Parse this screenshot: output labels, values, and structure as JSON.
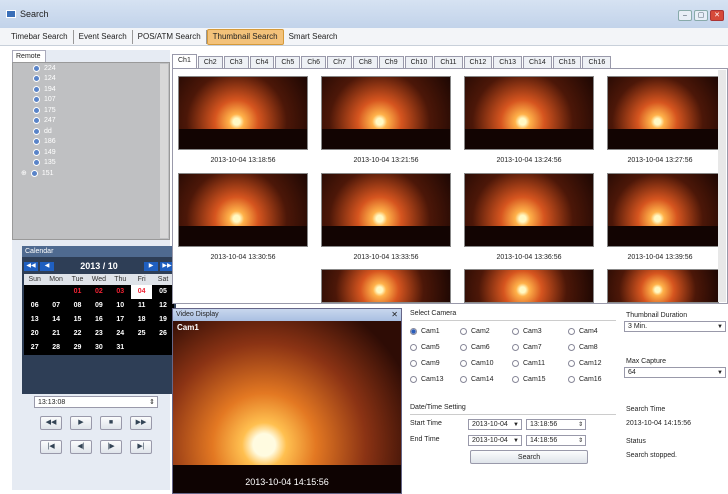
{
  "window": {
    "title": "Search",
    "min": "–",
    "max": "▢",
    "close": "✕"
  },
  "menu": [
    "Timebar Search",
    "Event Search",
    "POS/ATM Search",
    "Thumbnail Search",
    "Smart Search"
  ],
  "remote": {
    "tab": "Remote",
    "items": [
      "224",
      "124",
      "194",
      "107",
      "175",
      "247",
      "dd",
      "186",
      "149",
      "135",
      "151"
    ]
  },
  "calendar": {
    "title": "Calendar",
    "month": "2013 / 10",
    "dow": [
      "Sun",
      "Mon",
      "Tue",
      "Wed",
      "Thu",
      "Fri",
      "Sat"
    ],
    "weeks": [
      [
        "",
        "",
        "01",
        "02",
        "03",
        "04",
        "05"
      ],
      [
        "06",
        "07",
        "08",
        "09",
        "10",
        "11",
        "12"
      ],
      [
        "13",
        "14",
        "15",
        "16",
        "17",
        "18",
        "19"
      ],
      [
        "20",
        "21",
        "22",
        "23",
        "24",
        "25",
        "26"
      ],
      [
        "27",
        "28",
        "29",
        "30",
        "31",
        "",
        ""
      ]
    ]
  },
  "time": "13:13:08",
  "playback": [
    [
      "◀◀",
      "▶",
      "■",
      "▶▶"
    ],
    [
      "|◀",
      "◀|",
      "|▶",
      "▶|"
    ]
  ],
  "channels": [
    "Ch1",
    "Ch2",
    "Ch3",
    "Ch4",
    "Ch5",
    "Ch6",
    "Ch7",
    "Ch8",
    "Ch9",
    "Ch10",
    "Ch11",
    "Ch12",
    "Ch13",
    "Ch14",
    "Ch15",
    "Ch16"
  ],
  "thumbs": [
    "2013-10-04 13:18:56",
    "2013-10-04 13:21:56",
    "2013-10-04 13:24:56",
    "2013-10-04 13:27:56",
    "2013-10-04 13:30:56",
    "2013-10-04 13:33:56",
    "2013-10-04 13:36:56",
    "2013-10-04 13:39:56"
  ],
  "video": {
    "title": "Video Display",
    "close": "✕",
    "cam": "Cam1",
    "stamp": "2013-10-04 14:15:56"
  },
  "select_camera": {
    "label": "Select Camera",
    "cams": [
      "Cam1",
      "Cam2",
      "Cam3",
      "Cam4",
      "Cam5",
      "Cam6",
      "Cam7",
      "Cam8",
      "Cam9",
      "Cam10",
      "Cam11",
      "Cam12",
      "Cam13",
      "Cam14",
      "Cam15",
      "Cam16"
    ],
    "selected": "Cam1"
  },
  "datetime": {
    "label": "Date/Time Setting",
    "start_label": "Start Time",
    "start_date": "2013-10-04",
    "start_time": "13:18:56",
    "end_label": "End Time",
    "end_date": "2013-10-04",
    "end_time": "14:18:56"
  },
  "search_btn": "Search",
  "thumb_duration": {
    "label": "Thumbnail Duration",
    "value": "3 Min."
  },
  "max_capture": {
    "label": "Max Capture",
    "value": "64"
  },
  "search_time": {
    "label": "Search Time",
    "value": "2013-10-04 14:15:56"
  },
  "status": {
    "label": "Status",
    "value": "Search stopped."
  }
}
